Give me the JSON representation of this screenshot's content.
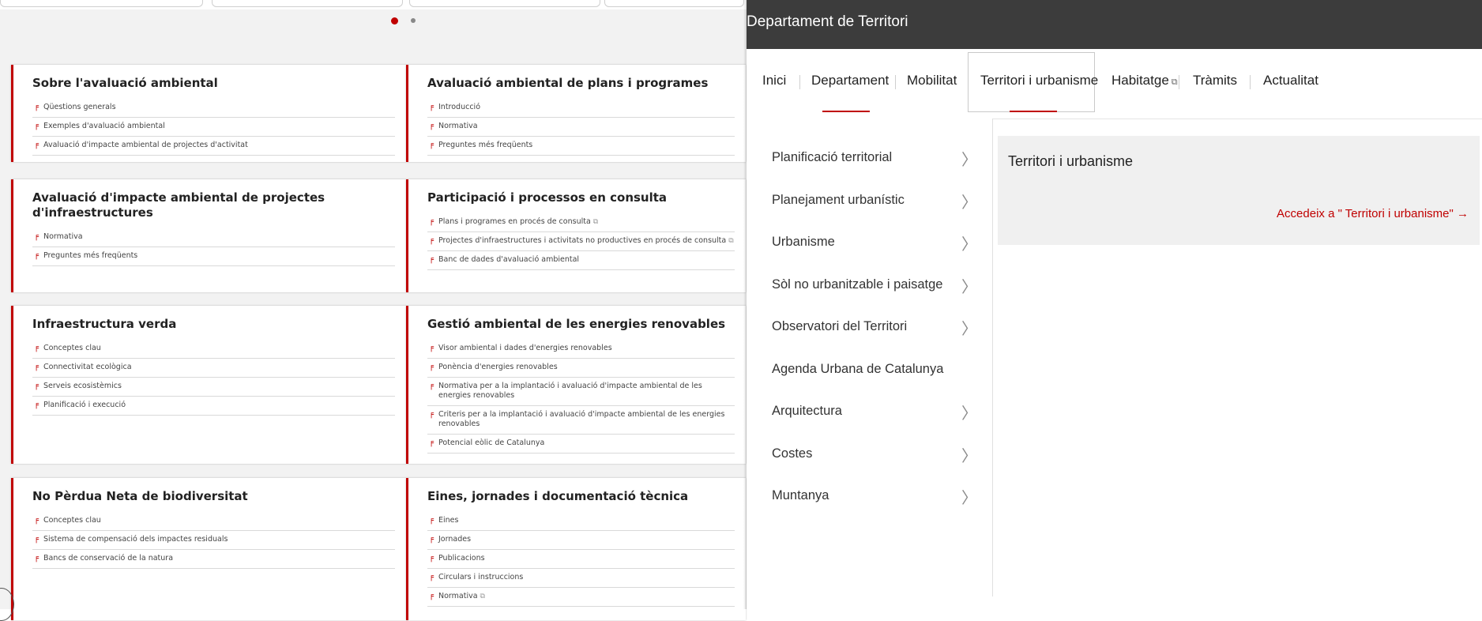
{
  "carousel": {
    "dots": [
      "active",
      "inactive"
    ]
  },
  "cards": [
    {
      "title": "Sobre l'avaluació ambiental",
      "links": [
        {
          "label": "Qüestions generals"
        },
        {
          "label": "Exemples d'avaluació ambiental"
        },
        {
          "label": "Avaluació d'impacte ambiental de projectes d'activitat"
        }
      ]
    },
    {
      "title": "Avaluació ambiental de plans i programes",
      "links": [
        {
          "label": "Introducció"
        },
        {
          "label": "Normativa"
        },
        {
          "label": "Preguntes més freqüents"
        }
      ]
    },
    {
      "title": "Avaluació d'impacte ambiental de projectes d'infraestructures",
      "links": [
        {
          "label": "Normativa"
        },
        {
          "label": "Preguntes més freqüents"
        }
      ]
    },
    {
      "title": "Participació i processos en consulta",
      "links": [
        {
          "label": "Plans i programes en procés de consulta",
          "external": true
        },
        {
          "label": "Projectes d'infraestructures i activitats no productives en procés de consulta",
          "external": true
        },
        {
          "label": "Banc de dades d'avaluació ambiental"
        }
      ]
    },
    {
      "title": "Infraestructura verda",
      "links": [
        {
          "label": "Conceptes clau"
        },
        {
          "label": "Connectivitat ecològica"
        },
        {
          "label": "Serveis ecosistèmics"
        },
        {
          "label": "Planificació i execució"
        }
      ]
    },
    {
      "title": "Gestió ambiental de les energies renovables",
      "links": [
        {
          "label": "Visor ambiental i dades d'energies renovables"
        },
        {
          "label": "Ponència d'energies renovables"
        },
        {
          "label": "Normativa per a la implantació i avaluació d'impacte ambiental de les energies renovables"
        },
        {
          "label": "Criteris per a la implantació i avaluació d'impacte ambiental de les energies renovables"
        },
        {
          "label": "Potencial eòlic de Catalunya"
        }
      ]
    },
    {
      "title": "No Pèrdua Neta de biodiversitat",
      "links": [
        {
          "label": "Conceptes clau"
        },
        {
          "label": "Sistema de compensació dels impactes residuals"
        },
        {
          "label": "Bancs de conservació de la natura"
        }
      ]
    },
    {
      "title": "Eines, jornades i documentació tècnica",
      "links": [
        {
          "label": "Eines"
        },
        {
          "label": "Jornades"
        },
        {
          "label": "Publicacions"
        },
        {
          "label": "Circulars i instruccions"
        },
        {
          "label": "Normativa",
          "external": true
        }
      ]
    }
  ],
  "panel": {
    "department_title": "Departament de Territori",
    "nav": [
      {
        "label": "Inici"
      },
      {
        "label": "Departament"
      },
      {
        "label": "Mobilitat"
      },
      {
        "label": "Territori i urbanisme",
        "active": true
      },
      {
        "label": "Habitatge",
        "external": true
      },
      {
        "label": "Tràmits"
      },
      {
        "label": "Actualitat"
      }
    ],
    "side_menu": [
      {
        "label": "Planificació territorial",
        "chevron": true
      },
      {
        "label": "Planejament urbanístic",
        "chevron": true
      },
      {
        "label": "Urbanisme",
        "chevron": true
      },
      {
        "label": "Sòl no urbanitzable i paisatge",
        "chevron": true
      },
      {
        "label": "Observatori del Territori",
        "chevron": true
      },
      {
        "label": "Agenda Urbana de Catalunya",
        "chevron": false
      },
      {
        "label": "Arquitectura",
        "chevron": true
      },
      {
        "label": "Costes",
        "chevron": true
      },
      {
        "label": "Muntanya",
        "chevron": true
      }
    ],
    "content": {
      "title": "Territori i urbanisme",
      "link": "Accedeix a \" Territori i urbanisme\" →"
    }
  },
  "icons": {
    "link_mark": "red-flag-icon",
    "external": "external-link-icon",
    "chevron": "chevron-right-icon"
  },
  "colors": {
    "accent": "#c00000",
    "header": "#3c3c3c",
    "content_bg": "#f0f0f0"
  }
}
